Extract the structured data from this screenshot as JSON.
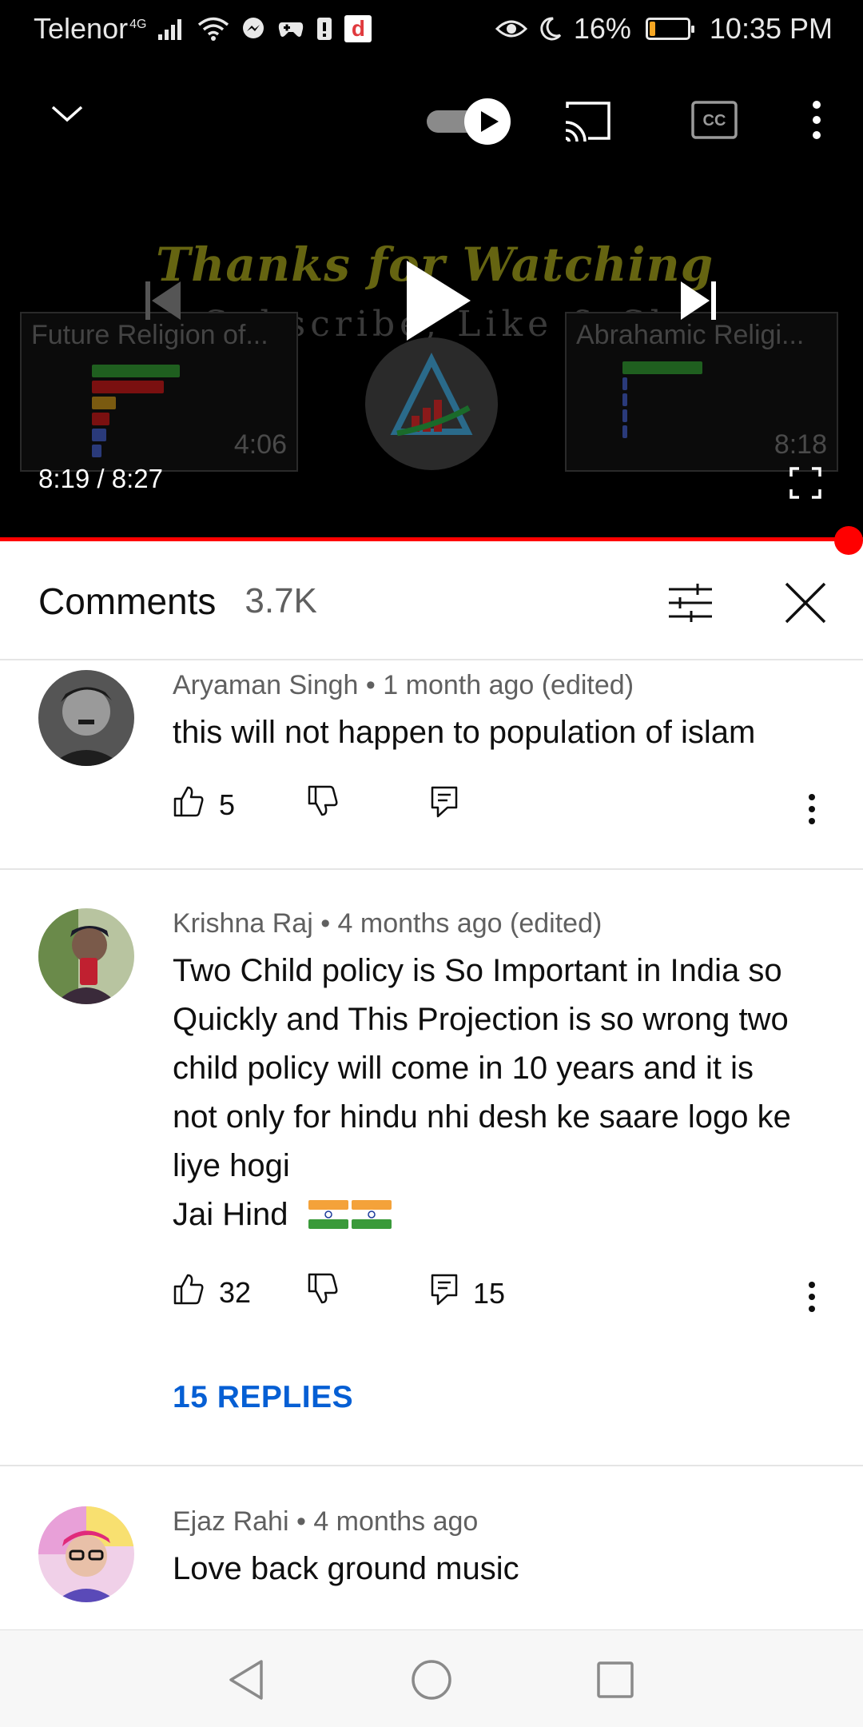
{
  "status_bar": {
    "carrier": "Telenor",
    "network": "4G",
    "battery_percent": "16%",
    "battery_level": 0.16,
    "time": "10:35 PM",
    "icons": [
      "signal-icon",
      "wifi-icon",
      "messenger-icon",
      "game-icon",
      "sim-icon",
      "daraz-app-icon",
      "eye-comfort-icon",
      "moon-icon",
      "battery-icon"
    ]
  },
  "player": {
    "end_card_title": "Thanks for Watching",
    "end_card_subtitle": "Subscribe, Like & Share",
    "suggested_left": {
      "title": "Future Religion of...",
      "duration": "4:06"
    },
    "suggested_right": {
      "title": "Abrahamic Religi...",
      "duration": "8:18"
    },
    "current_time": "8:19",
    "separator": " / ",
    "total_time": "8:27",
    "progress": 0.984,
    "autoplay_on": true,
    "icons": [
      "collapse-chevron-icon",
      "autoplay-toggle-icon",
      "cast-icon",
      "captions-icon",
      "more-vert-icon",
      "previous-icon",
      "play-icon",
      "next-icon",
      "fullscreen-icon"
    ]
  },
  "comments_header": {
    "title": "Comments",
    "count": "3.7K",
    "icons": [
      "sort-filter-icon",
      "close-icon"
    ]
  },
  "comments": [
    {
      "author": "Aryaman Singh",
      "age": "1 month ago (edited)",
      "lines": [
        "this will not happen to population of islam"
      ],
      "likes": "5",
      "reply_count": ""
    },
    {
      "author": "Krishna Raj",
      "age": "4 months ago (edited)",
      "lines": [
        "Two Child policy is So Important in India so",
        "Quickly and This Projection is so wrong two",
        "child policy will come in 10 years  and it is",
        "not only for hindu nhi desh ke saare logo ke",
        "liye hogi",
        "Jai Hind"
      ],
      "likes": "32",
      "reply_count": "15",
      "replies_label": "15 REPLIES"
    },
    {
      "author": "Ejaz Rahi",
      "age": "4 months ago",
      "lines": [
        "Love back ground music"
      ]
    }
  ],
  "meta_separator": " • ",
  "colors": {
    "progress_red": "#ff0000",
    "link_blue": "#065fd4",
    "secondary_text": "#606060"
  },
  "nav_bar": {
    "icons": [
      "back-icon",
      "home-icon",
      "recents-icon"
    ]
  }
}
